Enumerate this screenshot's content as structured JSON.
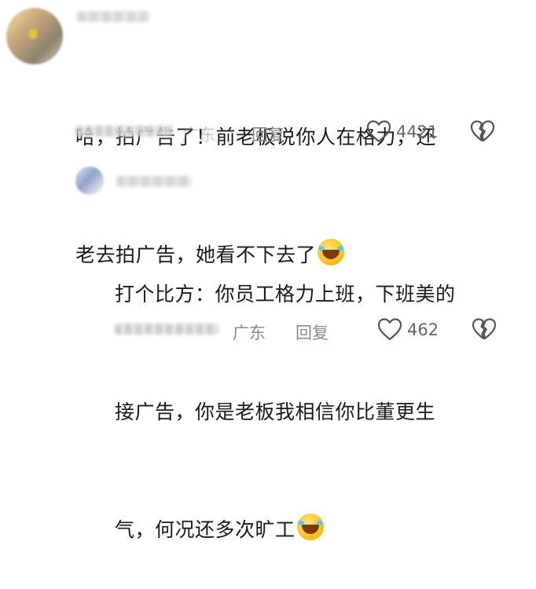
{
  "comments": [
    {
      "text_line1": "哈，拍广告了！前老板说你人在格力，还",
      "text_line2": "老去拍广告，她看不下去了",
      "emoji": "rolling-laughing-emoji",
      "location": "广东",
      "reply_label": "回复",
      "likes": "4421"
    },
    {
      "text_line1": "打个比方：你员工格力上班，下班美的",
      "text_line2": "接广告，你是老板我相信你比董更生",
      "text_line3": "气，何况还多次旷工",
      "emoji": "rolling-laughing-emoji",
      "location": "广东",
      "reply_label": "回复",
      "likes": "462"
    }
  ],
  "icons": {
    "like": "heart-outline-icon",
    "dislike": "broken-heart-icon"
  },
  "colors": {
    "text": "#1a1a1a",
    "meta": "#8a8a8a",
    "icon": "#555555"
  }
}
